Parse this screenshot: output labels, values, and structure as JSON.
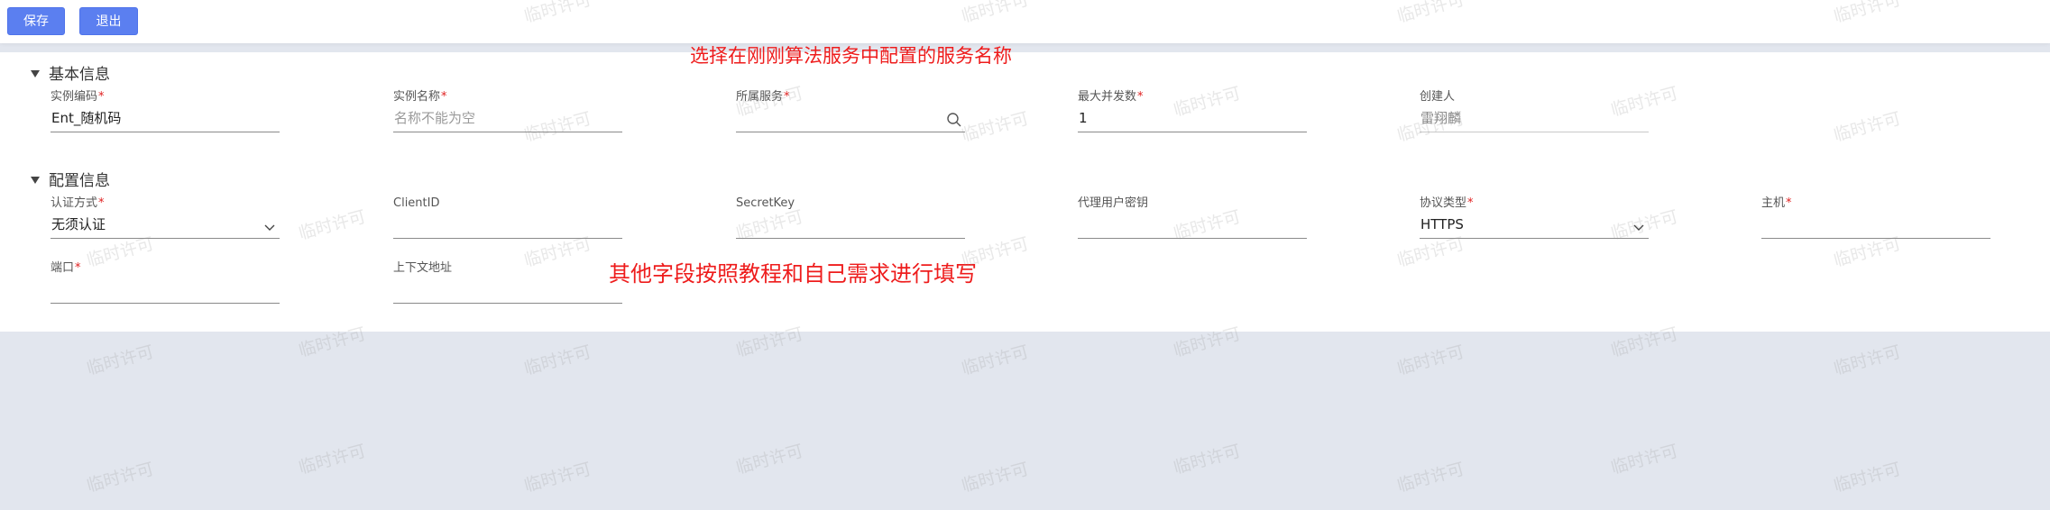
{
  "toolbar": {
    "save_label": "保存",
    "exit_label": "退出"
  },
  "annotations": {
    "service_hint": "选择在刚刚算法服务中配置的服务名称",
    "fields_hint": "其他字段按照教程和自己需求进行填写"
  },
  "sections": {
    "basic": {
      "title": "基本信息",
      "fields": {
        "instance_code": {
          "label": "实例编码",
          "required": "*",
          "value": "Ent_随机码"
        },
        "instance_name": {
          "label": "实例名称",
          "required": "*",
          "placeholder": "名称不能为空"
        },
        "service": {
          "label": "所属服务",
          "required": "*",
          "value": ""
        },
        "max_concurrency": {
          "label": "最大并发数",
          "required": "*",
          "value": "1"
        },
        "creator": {
          "label": "创建人",
          "value": "雷翔麟"
        }
      }
    },
    "config": {
      "title": "配置信息",
      "fields": {
        "auth_method": {
          "label": "认证方式",
          "required": "*",
          "value": "无须认证"
        },
        "client_id": {
          "label": "ClientID",
          "value": ""
        },
        "secret_key": {
          "label": "SecretKey",
          "value": ""
        },
        "proxy_user_key": {
          "label": "代理用户密钥",
          "value": ""
        },
        "protocol": {
          "label": "协议类型",
          "required": "*",
          "value": "HTTPS"
        },
        "host": {
          "label": "主机",
          "required": "*",
          "value": ""
        },
        "port": {
          "label": "端口",
          "required": "*",
          "value": ""
        },
        "context_path": {
          "label": "上下文地址",
          "value": ""
        }
      }
    }
  },
  "watermark": {
    "text": "临时许可"
  },
  "colors": {
    "primary": "#5b7ff0",
    "required": "#e02020",
    "annotation": "#ee1c1c",
    "background": "#e2e6ee"
  },
  "icons": {
    "service_search": "search-icon",
    "auth_dropdown": "chevron-down-icon",
    "protocol_dropdown": "chevron-down-icon",
    "section_toggle": "caret-down-icon"
  }
}
